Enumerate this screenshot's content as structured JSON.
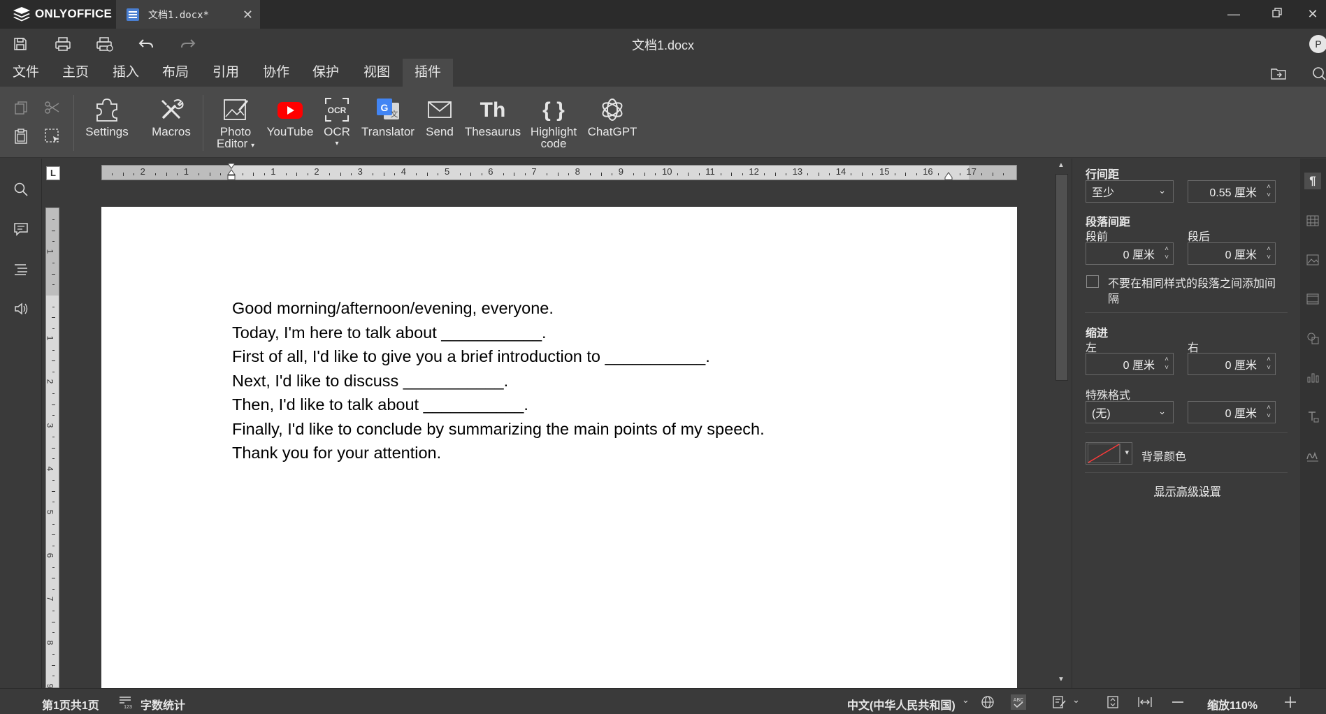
{
  "app": {
    "brand": "ONLYOFFICE"
  },
  "tab": {
    "title": "文档1.docx*"
  },
  "document": {
    "title": "文档1.docx"
  },
  "user": {
    "initial": "P"
  },
  "menu": [
    "文件",
    "主页",
    "插入",
    "布局",
    "引用",
    "协作",
    "保护",
    "视图",
    "插件"
  ],
  "active_menu": "插件",
  "toolbar": {
    "settings": "Settings",
    "macros": "Macros",
    "photo_editor": "Photo Editor",
    "youtube": "YouTube",
    "ocr": "OCR",
    "translator": "Translator",
    "send": "Send",
    "thesaurus": "Thesaurus",
    "highlight_code": "Highlight code",
    "chatgpt": "ChatGPT",
    "photo_line1": "Photo",
    "photo_line2": "Editor",
    "highlight_line1": "Highlight",
    "highlight_line2": "code",
    "ocr_glyph": "OCR",
    "thesaurus_glyph": "Th",
    "highlight_glyph": "{ }"
  },
  "ruler": {
    "corner": "L",
    "h_labels": [
      "2",
      "1",
      "1",
      "2",
      "3",
      "4",
      "5",
      "6",
      "7",
      "8",
      "9",
      "10",
      "11",
      "12",
      "13",
      "14",
      "15",
      "16",
      "17"
    ],
    "v_labels": [
      "1",
      "1",
      "2",
      "3",
      "4",
      "5",
      "6",
      "7",
      "8",
      "9"
    ]
  },
  "body_text": [
    "Good morning/afternoon/evening, everyone.",
    "Today, I'm here to talk about ___________.",
    "First of all, I'd like to give you a brief introduction to ___________.",
    "Next, I'd like to discuss ___________.",
    "Then, I'd like to talk about ___________.",
    "Finally, I'd like to conclude by summarizing the main points of my speech.",
    "Thank you for your attention."
  ],
  "paragraph_panel": {
    "line_spacing_label": "行间距",
    "line_spacing_mode": "至少",
    "line_spacing_value": "0.55 厘米",
    "para_spacing_label": "段落间距",
    "before_label": "段前",
    "after_label": "段后",
    "before_value": "0 厘米",
    "after_value": "0 厘米",
    "no_space_same_style_line1": "不要在相同样式的段落之间添加间",
    "no_space_same_style_line2": "隔",
    "indent_label": "缩进",
    "left_label": "左",
    "right_label": "右",
    "left_value": "0 厘米",
    "right_value": "0 厘米",
    "special_label": "特殊格式",
    "special_mode": "(无)",
    "special_value": "0 厘米",
    "bg_color_label": "背景颜色",
    "advanced_link": "显示高级设置"
  },
  "status": {
    "page_info": "第1页共1页",
    "word_count": "字数统计",
    "language": "中文(中华人民共和国)",
    "zoom": "缩放110%"
  }
}
